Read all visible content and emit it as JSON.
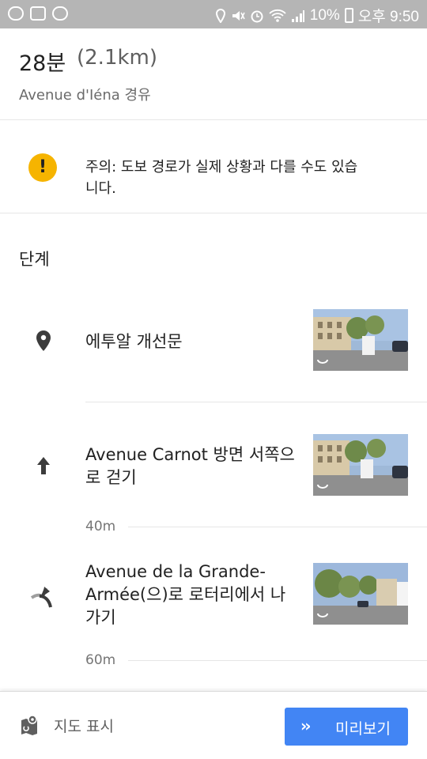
{
  "status_bar": {
    "battery": "10%",
    "time": "오후 9:50",
    "icons": [
      "app-icon",
      "gallery-icon",
      "talk-icon",
      "location-icon",
      "mute-icon",
      "alarm-icon",
      "wifi-icon",
      "signal-icon",
      "battery-icon"
    ]
  },
  "route": {
    "duration": "28분",
    "distance": "(2.1km)",
    "via": "Avenue d'Iéna 경유"
  },
  "warning": {
    "icon": "warning-icon",
    "color": "#f6b400",
    "text": "주의: 도보 경로가 실제 상황과 다를 수도 있습니다."
  },
  "steps_heading": "단계",
  "steps": [
    {
      "icon": "place-pin-icon",
      "text": "에투알 개선문",
      "distance_after": ""
    },
    {
      "icon": "arrow-up-icon",
      "text": "Avenue Carnot 방면 서쪽으로 걷기",
      "distance_after": "40m"
    },
    {
      "icon": "roundabout-exit-icon",
      "text": "Avenue de la Grande-Armée(으)로 로터리에서 나가기",
      "distance_after": "60m"
    }
  ],
  "bottom_bar": {
    "map_label": "지도 표시",
    "preview_label": "미리보기",
    "accent": "#4285f4"
  }
}
